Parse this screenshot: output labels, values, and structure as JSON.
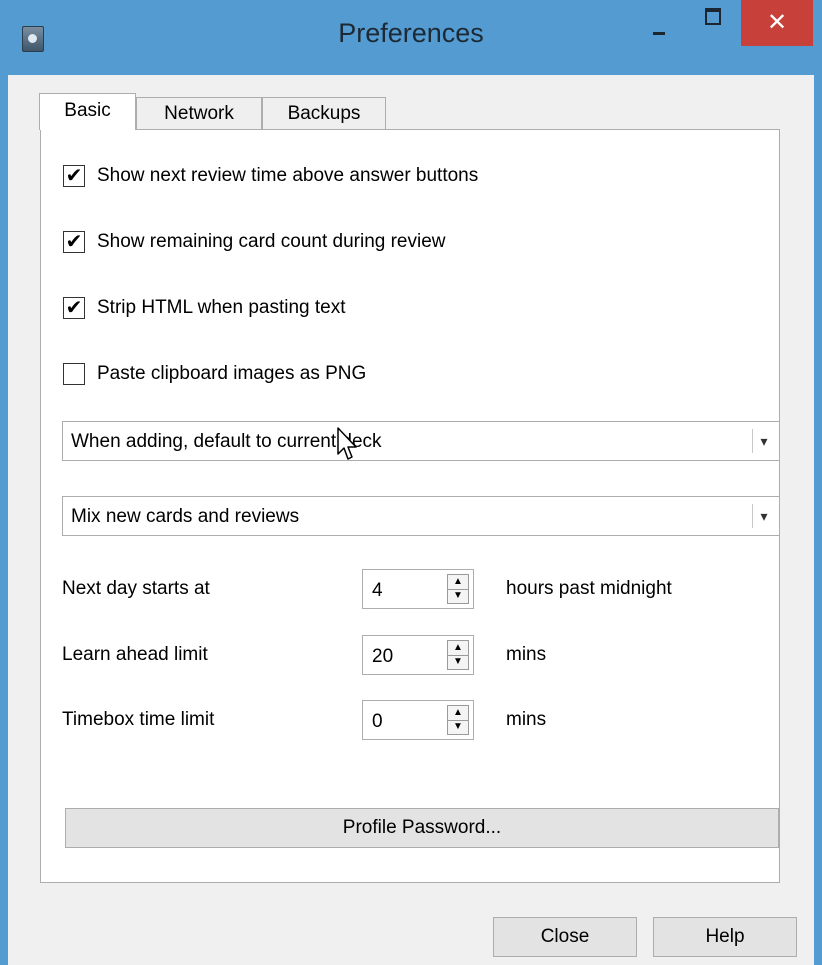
{
  "window": {
    "title": "Preferences",
    "app_icon": "anki-app-icon",
    "controls": {
      "minimize": "minimize-icon",
      "maximize": "maximize-icon",
      "close": "✕"
    }
  },
  "tabs": [
    {
      "label": "Basic",
      "active": true
    },
    {
      "label": "Network",
      "active": false
    },
    {
      "label": "Backups",
      "active": false
    }
  ],
  "basic": {
    "checkboxes": [
      {
        "label": "Show next review time above answer buttons",
        "checked": true,
        "mark": "✔"
      },
      {
        "label": "Show remaining card count during review",
        "checked": true,
        "mark": "✔"
      },
      {
        "label": "Strip HTML when pasting text",
        "checked": true,
        "mark": "✔"
      },
      {
        "label": "Paste clipboard images as PNG",
        "checked": false,
        "mark": ""
      }
    ],
    "dropdowns": [
      {
        "selected": "When adding, default to current deck",
        "arrow": "▾"
      },
      {
        "selected": "Mix new cards and reviews",
        "arrow": "▾"
      }
    ],
    "spinners": [
      {
        "label": "Next day starts at",
        "value": "4",
        "unit": "hours past midnight"
      },
      {
        "label": "Learn ahead limit",
        "value": "20",
        "unit": "mins"
      },
      {
        "label": "Timebox time limit",
        "value": "0",
        "unit": "mins"
      }
    ],
    "spin_up": "▲",
    "spin_down": "▼",
    "profile_password_label": "Profile Password..."
  },
  "footer": {
    "close_label": "Close",
    "help_label": "Help"
  },
  "colors": {
    "titlebar": "#539bd0",
    "close_button": "#c7403a",
    "dialog_bg": "#f0f0f0",
    "panel_bg": "#ffffff"
  },
  "cursor": "mouse-pointer-icon"
}
